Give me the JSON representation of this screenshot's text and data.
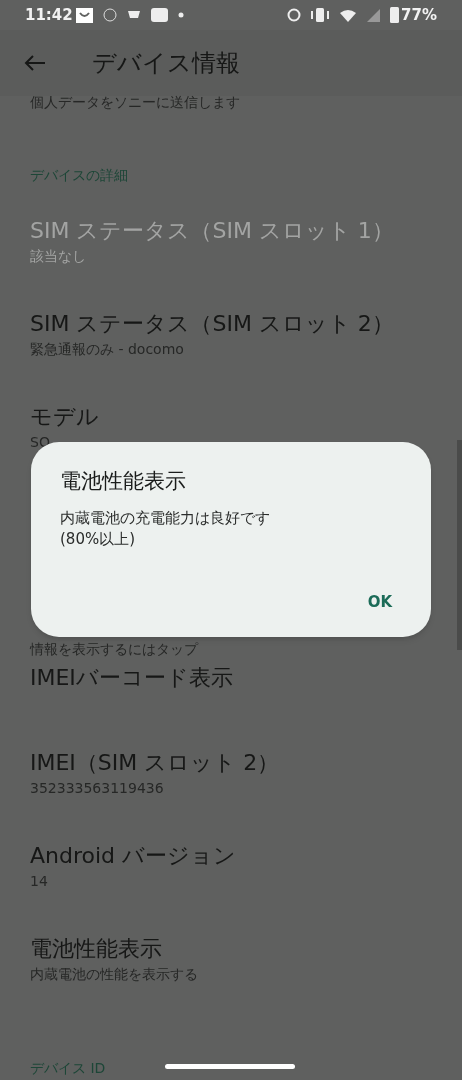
{
  "status_bar": {
    "time": "11:42",
    "battery": "77%"
  },
  "app_bar": {
    "title": "デバイス情報"
  },
  "top_partial": {
    "text": "個人データをソニーに送信します"
  },
  "sections": [
    {
      "header": "デバイスの詳細",
      "items": [
        {
          "title": "SIM ステータス（SIM スロット 1）",
          "subtitle": "該当なし",
          "disabled": true
        },
        {
          "title": "SIM ステータス（SIM スロット 2）",
          "subtitle": "緊急通報のみ - docomo",
          "disabled": false
        },
        {
          "title": "モデル",
          "subtitle": "SO",
          "disabled": false
        },
        {
          "subtitle": "情報を表示するにはタップ",
          "disabled": false
        },
        {
          "title": "IMEIバーコード表示",
          "disabled": false
        },
        {
          "title": "IMEI（SIM スロット 2）",
          "subtitle": "352333563119436",
          "disabled": false
        },
        {
          "title": "Android バージョン",
          "subtitle": "14",
          "disabled": false
        },
        {
          "title": "電池性能表示",
          "subtitle": "内蔵電池の性能を表示する",
          "disabled": false
        }
      ]
    },
    {
      "header": "デバイス ID"
    }
  ],
  "dialog": {
    "title": "電池性能表示",
    "message": "内蔵電池の充電能力は良好です\n(80%以上)",
    "button": "OK"
  }
}
